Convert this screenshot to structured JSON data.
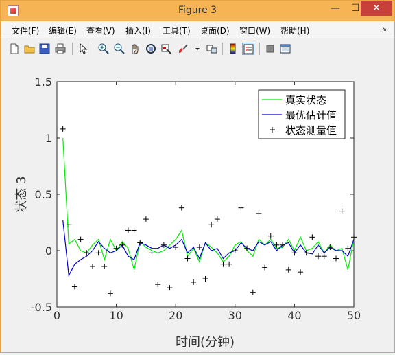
{
  "window": {
    "title": "Figure 3",
    "min_glyph": "—",
    "max_glyph": "☐",
    "close_glyph": "✕"
  },
  "menu": [
    "文件(F)",
    "编辑(E)",
    "查看(V)",
    "插入(I)",
    "工具(T)",
    "桌面(D)",
    "窗口(W)",
    "帮助(H)"
  ],
  "toolbar_icons": [
    "new-file-icon",
    "open-folder-icon",
    "save-icon",
    "print-icon",
    "pointer-icon",
    "zoom-in-icon",
    "zoom-out-icon",
    "pan-hand-icon",
    "rotate-3d-icon",
    "data-cursor-icon",
    "brush-icon",
    "link-plot-icon",
    "colorbar-icon",
    "legend-icon",
    "hide-plot-tools-icon",
    "show-plot-tools-icon"
  ],
  "colors": {
    "true_state": "#00ee00",
    "optimal_estimate": "#0000cc",
    "measurement": "#000000",
    "titlebar": "#f7b454",
    "close_button": "#c7403a"
  },
  "chart_data": {
    "type": "line",
    "xlabel": "时间(分钟)",
    "ylabel": "状态 3",
    "xlim": [
      0,
      50
    ],
    "ylim": [
      -0.5,
      1.5
    ],
    "xticks": [
      "0",
      "10",
      "20",
      "30",
      "40",
      "50"
    ],
    "yticks": [
      "-0.5",
      "0",
      "0.5",
      "1",
      "1.5"
    ],
    "legend_position": "top-right",
    "x": [
      1,
      2,
      3,
      4,
      5,
      6,
      7,
      8,
      9,
      10,
      11,
      12,
      13,
      14,
      15,
      16,
      17,
      18,
      19,
      20,
      21,
      22,
      23,
      24,
      25,
      26,
      27,
      28,
      29,
      30,
      31,
      32,
      33,
      34,
      35,
      36,
      37,
      38,
      39,
      40,
      41,
      42,
      43,
      44,
      45,
      46,
      47,
      48,
      49,
      50
    ],
    "series": [
      {
        "name": "真实状态",
        "style": "line",
        "values": [
          1.0,
          0.06,
          0.1,
          0.0,
          -0.02,
          0.05,
          0.1,
          -0.08,
          0.1,
          0.0,
          0.08,
          0.02,
          -0.17,
          0.08,
          0.03,
          0.0,
          -0.02,
          0.0,
          0.05,
          0.1,
          0.18,
          -0.05,
          0.02,
          -0.1,
          0.07,
          0.03,
          -0.02,
          -0.1,
          -0.05,
          0.05,
          0.08,
          0.0,
          -0.05,
          0.1,
          0.05,
          0.1,
          0.02,
          0.03,
          0.1,
          0.0,
          0.12,
          0.0,
          0.02,
          0.08,
          -0.02,
          0.05,
          0.0,
          0.02,
          -0.17,
          0.1
        ]
      },
      {
        "name": "最优估计值",
        "style": "line",
        "values": [
          0.27,
          -0.22,
          -0.12,
          -0.08,
          -0.05,
          0.0,
          0.08,
          0.02,
          -0.02,
          0.0,
          0.05,
          -0.05,
          -0.08,
          0.07,
          0.05,
          0.02,
          0.02,
          0.05,
          0.02,
          0.05,
          0.1,
          -0.02,
          0.03,
          -0.07,
          0.07,
          0.0,
          0.02,
          -0.07,
          -0.02,
          0.0,
          0.07,
          0.02,
          0.0,
          0.08,
          0.05,
          0.08,
          0.0,
          0.05,
          0.07,
          -0.02,
          0.05,
          -0.02,
          -0.03,
          0.05,
          -0.02,
          0.03,
          0.0,
          0.0,
          -0.05,
          0.1
        ]
      },
      {
        "name": "状态测量值",
        "style": "marker",
        "values": [
          1.08,
          0.23,
          -0.32,
          0.1,
          -0.02,
          -0.14,
          -0.02,
          -0.14,
          -0.38,
          0.02,
          0.05,
          0.18,
          0.18,
          0.07,
          0.28,
          -0.02,
          -0.3,
          0.05,
          -0.33,
          0.03,
          0.38,
          -0.07,
          -0.28,
          0.03,
          -0.25,
          0.23,
          0.28,
          -0.12,
          -0.12,
          0.0,
          0.38,
          0.02,
          -0.37,
          0.33,
          -0.15,
          0.13,
          0.05,
          0.05,
          -0.17,
          -0.02,
          -0.19,
          -0.02,
          0.12,
          -0.05,
          -0.05,
          0.03,
          -0.07,
          0.35,
          0.02,
          0.12
        ]
      }
    ]
  }
}
